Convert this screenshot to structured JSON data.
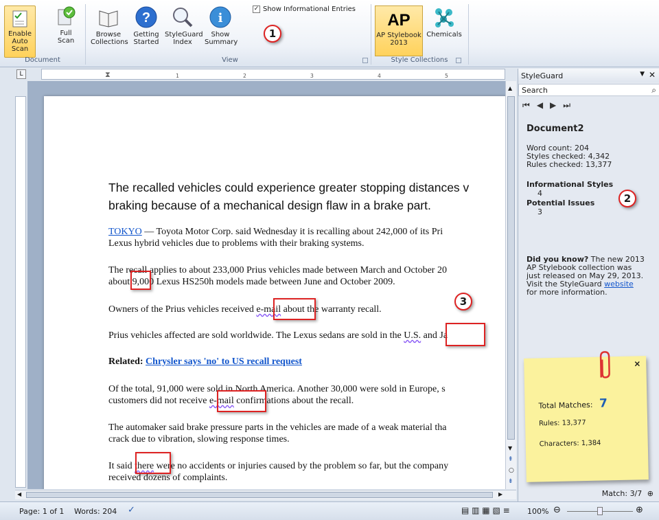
{
  "ribbon": {
    "buttons": {
      "enable_auto_scan": "Enable\nAuto Scan",
      "full_scan": "Full\nScan",
      "browse_collections": "Browse\nCollections",
      "getting_started": "Getting\nStarted",
      "styleguard_index": "StyleGuard\nIndex",
      "show_summary": "Show\nSummary",
      "ap_stylebook": "AP Stylebook\n2013",
      "chemicals": "Chemicals"
    },
    "show_informational_entries": "Show Informational Entries",
    "groups": {
      "document": "Document",
      "view": "View",
      "style_collections": "Style Collections"
    }
  },
  "ruler": {
    "numbers": [
      "1",
      "2",
      "3",
      "4",
      "5"
    ]
  },
  "document": {
    "headline_line1": "The recalled vehicles could experience greater stopping distances v",
    "headline_line2": "braking because of a mechanical design flaw in a brake part.",
    "p1_link": "TOKYO",
    "p1_rest": " — Toyota Motor Corp. said Wednesday it is recalling  about 242,000 of its Pri",
    "p1_line2": "Lexus hybrid vehicles due to problems  with their braking systems.",
    "p2_line1": "The recall applies to about 233,000 Prius vehicles made between March and October 20",
    "p2_line2": "about 9,000 Lexus HS250h models made between June and October 2009.",
    "p3_before": "Owners of the Prius vehicles received ",
    "p3_flag": "e-mail",
    "p3_after": " about the warranty recall.",
    "p4_before": "Prius vehicles affected are sold worldwide. The Lexus sedans are sold in the ",
    "p4_flag": "U.S.",
    "p4_after": " and Ja",
    "related_label": "Related: ",
    "related_link": "Chrysler says 'no' to US recall  request",
    "p5_line1": "Of the total, 91,000 were sold in North America.  Another 30,000 were sold in Europe, s",
    "p5_before": "customers did not receive ",
    "p5_flag": "e-mail",
    "p5_after": " confirmations about the recall.",
    "p6_line1": "The automaker said brake pressure parts in the vehicles  are made of a weak material  tha",
    "p6_line2": "crack due to vibration, slowing response times.",
    "p7_before": "It said ",
    "p7_flag": "there",
    "p7_after": " were no accidents or injuries  caused by the problem so far, but the company",
    "p7_line2": "received dozens of complaints."
  },
  "callouts": {
    "one": "1",
    "two": "2",
    "three": "3"
  },
  "panel": {
    "title": "StyleGuard",
    "search_placeholder": "Search",
    "doc_name": "Document2",
    "word_count": "Word count: 204",
    "styles_checked": "Styles checked: 4,342",
    "rules_checked": "Rules checked: 13,377",
    "informational_styles": "Informational Styles",
    "informational_count": "4",
    "potential_issues": "Potential Issues",
    "potential_count": "3",
    "did_you_know": "Did you know?",
    "dyk_text_1": " The new 2013",
    "dyk_text_2": "AP Stylebook collection was",
    "dyk_text_3": "just released on May 29, 2013.",
    "dyk_text_4": "Visit the StyleGuard ",
    "dyk_link": "website",
    "dyk_text_5": "for more information.",
    "note_total_label": "Total Matches:",
    "note_total_value": "7",
    "note_rules": "Rules: 13,377",
    "note_characters": "Characters: 1,384",
    "match": "Match: 3/7"
  },
  "status": {
    "page": "Page: 1 of 1",
    "words": "Words: 204",
    "zoom": "100%"
  },
  "colors": {
    "accent": "#1155cc",
    "markup": "#dd2222",
    "note": "#fbf29d"
  }
}
